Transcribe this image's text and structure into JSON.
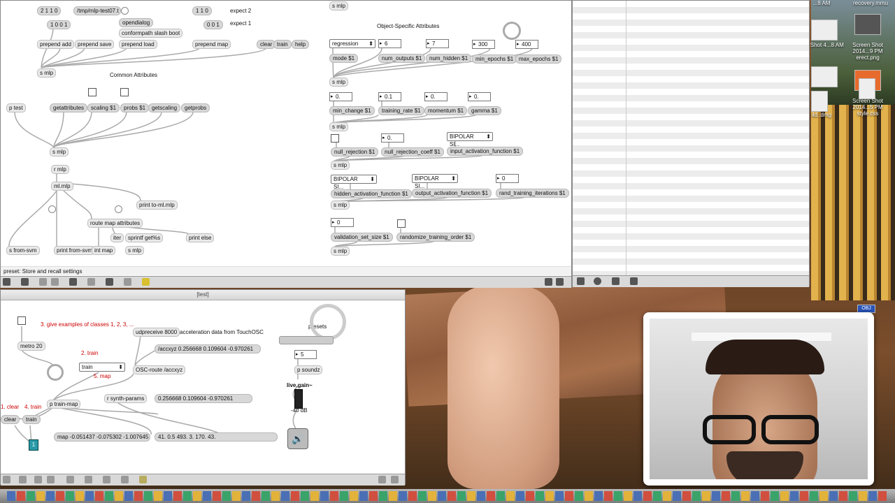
{
  "desktop": {
    "icons": [
      {
        "label": "...8 AM",
        "kind": "screenshot"
      },
      {
        "label": "recovery.mmu",
        "kind": "file"
      },
      {
        "label": "een Shot 4...8 AM",
        "kind": "screenshot"
      },
      {
        "label": "Screen Shot 2014...9 PM erect.png",
        "kind": "screenshot"
      },
      {
        "label": "ild..dmg",
        "kind": "disk-image"
      },
      {
        "label": "Screen Shot 2014...5 PM style.css",
        "kind": "css-file"
      },
      {
        "label": "OBJ",
        "kind": "document"
      }
    ]
  },
  "main_patcher": {
    "status_text": "preset: Store and recall settings",
    "comments": {
      "expect2": "expect 2",
      "expect1": "expect 1",
      "common_attributes": "Common Attributes",
      "object_specific_attributes": "Object-Specific Attributes"
    },
    "messages": {
      "m211": "2 1 1 0",
      "m1001": "1 0 0 1",
      "path": "/tmp/mlp-test07.t",
      "opendialog": "opendialog",
      "conformpath": "conformpath slash boot",
      "m110": "1 1 0",
      "m001": "0 0 1",
      "clear": "clear",
      "train": "train",
      "help": "help",
      "getattributes": "getattributes",
      "getscaling": "getscaling",
      "getprobs": "getprobs"
    },
    "objects": {
      "prepend_add": "prepend add",
      "prepend_save": "prepend save",
      "prepend_load": "prepend load",
      "prepend_map": "prepend map",
      "s_mlp": "s mlp",
      "p_test": "p test",
      "scaling": "scaling $1",
      "probs": "probs $1",
      "r_mlp": "r mlp",
      "ml_mlp": "ml.mlp",
      "print_to": "print to-ml.mlp",
      "route": "route map attributes",
      "iter": "iter",
      "sprintf": "sprintf get%s",
      "print_else": "print else",
      "s_from_svm": "s from-svm",
      "print_from_svm": "print from-svm",
      "int_map": "int map",
      "mode": "mode $1",
      "num_outputs": "num_outputs $1",
      "num_hidden": "num_hidden $1",
      "min_epochs": "min_epochs $1",
      "max_epochs": "max_epochs $1",
      "min_change": "min_change $1",
      "training_rate": "training_rate $1",
      "momentum": "momentum $1",
      "gamma": "gamma $1",
      "null_rejection": "null_rejection $1",
      "null_rejection_coeff": "null_rejection_coeff $1",
      "input_activation": "input_activation_function $1",
      "hidden_activation": "hidden_activation_function $1",
      "output_activation": "output_activation_function $1",
      "rand_training": "rand_training_iterations $1",
      "validation_set": "validation_set_size $1",
      "randomize_order": "randomize_training_order $1"
    },
    "numbers": {
      "outputs": "6",
      "hidden": "7",
      "min_epochs": "300",
      "max_epochs": "400",
      "min_change": "0.",
      "training_rate": "0.1",
      "momentum": "0.",
      "gamma": "0.",
      "null_coeff": "0.",
      "rand_iter": "0",
      "validation": "0"
    },
    "menus": {
      "mode": "regression",
      "input_act": "BIPOLAR SI...",
      "hidden_act": "BIPOLAR SI...",
      "output_act": "BIPOLAR SI..."
    }
  },
  "test_patcher": {
    "title": "[test]",
    "comments": {
      "step3": "3.  give examples of classes 1, 2, 3, ...",
      "acc_data": "acceleration data from TouchOSC",
      "step2": "2. train",
      "step5": "5. map",
      "step1": "1. clear",
      "step4": "4. train",
      "presets": "presets",
      "live_gain_db": "-40 dB"
    },
    "objects": {
      "udpreceive": "udpreceive 8000",
      "osc_route": "OSC-route /accxyz",
      "metro": "metro 20",
      "p_train_map": "p train-map",
      "r_synth": "r synth-params",
      "p_soundz": "p soundz",
      "live_gain": "live.gain~"
    },
    "messages": {
      "accxyz": "/accxyz 0.256668 0.109604 -0.970261",
      "accvals": "0.256668 0.109604 -0.970261",
      "map_out": "map -0.051437 -0.075302 -1.007645",
      "synth_vals": "41. 0.5 493. 3. 170. 43.",
      "clear": "clear",
      "train": "train"
    },
    "menus": {
      "mode": "train"
    },
    "numbers": {
      "preset": "5",
      "class": "1"
    }
  }
}
